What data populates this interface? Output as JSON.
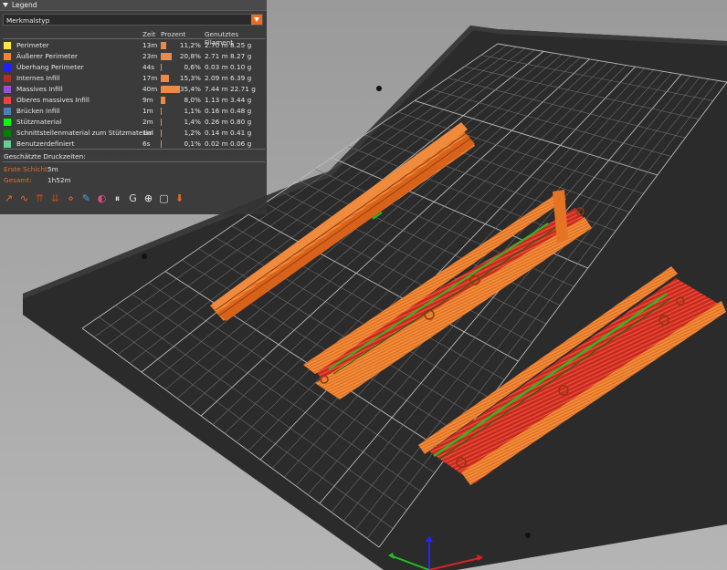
{
  "legend": {
    "header_label": "Legend",
    "view_type": {
      "selected": "Merkmalstyp"
    },
    "columns": {
      "time": "Zeit",
      "percent": "Prozent",
      "filament": "Genutztes Filament"
    },
    "features": [
      {
        "name": "Perimeter",
        "time": "13m",
        "percent": "11,2%",
        "meters": "2.70 m",
        "grams": "8.25 g",
        "color": "#ffe64d",
        "share": 0.112
      },
      {
        "name": "Äußerer Perimeter",
        "time": "23m",
        "percent": "20,8%",
        "meters": "2.71 m",
        "grams": "8.27 g",
        "color": "#ff7d38",
        "share": 0.208
      },
      {
        "name": "Überhang Perimeter",
        "time": "44s",
        "percent": "0,6%",
        "meters": "0.03 m",
        "grams": "0.10 g",
        "color": "#1f1fff",
        "share": 0.006
      },
      {
        "name": "Internes Infill",
        "time": "17m",
        "percent": "15,3%",
        "meters": "2.09 m",
        "grams": "6.39 g",
        "color": "#b03029",
        "share": 0.153
      },
      {
        "name": "Massives Infill",
        "time": "40m",
        "percent": "35,4%",
        "meters": "7.44 m",
        "grams": "22.71 g",
        "color": "#9654cc",
        "share": 0.354
      },
      {
        "name": "Oberes massives Infill",
        "time": "9m",
        "percent": "8,0%",
        "meters": "1.13 m",
        "grams": "3.44 g",
        "color": "#f04040",
        "share": 0.08
      },
      {
        "name": "Brücken Infill",
        "time": "1m",
        "percent": "1,1%",
        "meters": "0.16 m",
        "grams": "0.48 g",
        "color": "#4d80ba",
        "share": 0.011
      },
      {
        "name": "Stützmaterial",
        "time": "2m",
        "percent": "1,4%",
        "meters": "0.26 m",
        "grams": "0.80 g",
        "color": "#00ff00",
        "share": 0.014
      },
      {
        "name": "Schnittstellenmaterial zum Stützmaterial",
        "time": "1m",
        "percent": "1,2%",
        "meters": "0.14 m",
        "grams": "0.41 g",
        "color": "#008000",
        "share": 0.012
      },
      {
        "name": "Benutzerdefiniert",
        "time": "6s",
        "percent": "0,1%",
        "meters": "0.02 m",
        "grams": "0.06 g",
        "color": "#5ed194",
        "share": 0.001
      }
    ],
    "estimated": {
      "title": "Geschätzte Druckzeiten:",
      "first_layer_label": "Erste Schicht:",
      "first_layer_value": "5m",
      "total_label": "Gesamt:",
      "total_value": "1h52m"
    }
  },
  "toolbar": {
    "icons": [
      "travel-icon",
      "wipe-icon",
      "retractions-icon",
      "deretractions-icon",
      "seams-icon",
      "tool-changes-icon",
      "color-changes-icon",
      "pause-prints-icon",
      "custom-gcodes-icon",
      "center-of-gravity-icon",
      "shells-icon",
      "tool-marker-icon"
    ]
  },
  "colors": {
    "accent": "#ed6b21",
    "bed": "#2b2b2b",
    "grid": "#8c8c8c",
    "part": "#e0701e",
    "infill": "#c8281e",
    "support": "#22c022",
    "background": "#a9a9a9"
  }
}
